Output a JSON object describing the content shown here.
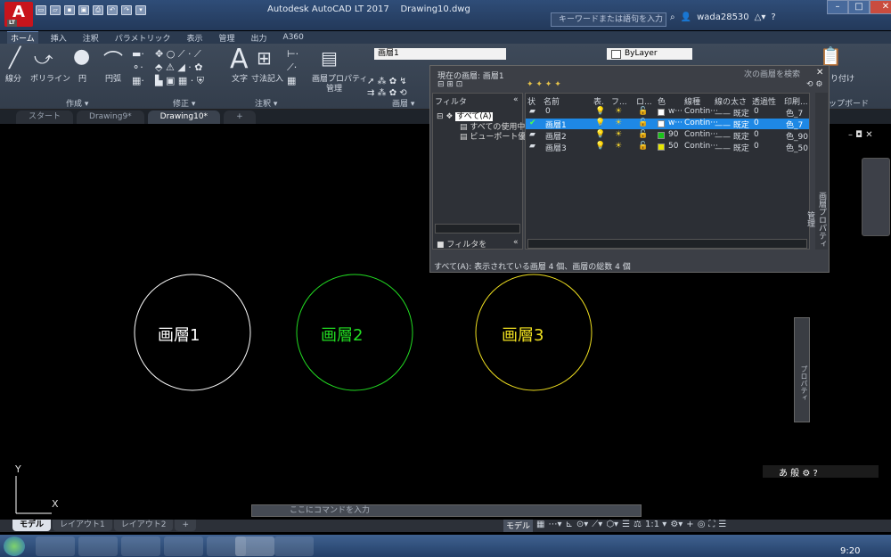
{
  "window": {
    "title": "Autodesk AutoCAD LT 2017",
    "file": "Drawing10.dwg",
    "search_placeholder": "キーワードまたは語句を入力",
    "user": "wada28530",
    "logo_letter": "A",
    "logo_sub": "LT"
  },
  "ribbon": {
    "tabs": [
      "ホーム",
      "挿入",
      "注釈",
      "パラメトリック",
      "表示",
      "管理",
      "出力",
      "A360"
    ],
    "active_tab": 0,
    "draw_tools": [
      "線分",
      "ポリライン",
      "円",
      "円弧"
    ],
    "annot_tools": [
      "文字",
      "寸法記入"
    ],
    "layer_props_label": "画層プロパティ",
    "layer_props_sub": "管理",
    "current_layer": "画層1",
    "bylayer": "ByLayer",
    "panels": {
      "draw": "作成 ▾",
      "modify": "修正 ▾",
      "annotation": "注釈 ▾",
      "layers": "画層 ▾",
      "clipboard": "ップボード",
      "paste_label": "り付け"
    }
  },
  "file_tabs": [
    "スタート",
    "Drawing9*",
    "Drawing10*",
    "+"
  ],
  "layer_palette": {
    "current": "現在の画層: 画層1",
    "search": "次の画層を検索",
    "filter_header": "フィルタ",
    "filter_collapse": "«",
    "filters": [
      "すべて(A)",
      "すべての使用中",
      "ビューポート優"
    ],
    "invert_filter": "フィルタを",
    "columns": [
      "状",
      "名前",
      "表.",
      "フ...",
      "ロ...",
      "色",
      "線種",
      "線の太さ",
      "透過性",
      "印刷..."
    ],
    "rows": [
      {
        "name": "0",
        "color_label": "w···",
        "color": "#ffffff",
        "linetype": "Contin···",
        "lineweight": "—— 既定",
        "transparency": "0",
        "plot": "色_7",
        "selected": false
      },
      {
        "name": "画層1",
        "color_label": "w···",
        "color": "#ffffff",
        "linetype": "Contin···",
        "lineweight": "—— 既定",
        "transparency": "0",
        "plot": "色_7",
        "selected": true
      },
      {
        "name": "画層2",
        "color_label": "90",
        "color": "#19c419",
        "linetype": "Contin···",
        "lineweight": "—— 既定",
        "transparency": "0",
        "plot": "色_90",
        "selected": false
      },
      {
        "name": "画層3",
        "color_label": "50",
        "color": "#e6e600",
        "linetype": "Contin···",
        "lineweight": "—— 既定",
        "transparency": "0",
        "plot": "色_50",
        "selected": false
      }
    ],
    "status": "すべて(A): 表示されている画層 4 個、画層の総数 4 個",
    "side_label": "画層プロパティ管理"
  },
  "drawing": {
    "circles": [
      {
        "label": "画層1",
        "color": "#ffffff"
      },
      {
        "label": "画層2",
        "color": "#22dd22"
      },
      {
        "label": "画層3",
        "color": "#f0e020"
      }
    ],
    "axis_y": "Y",
    "axis_x": "X"
  },
  "props_label": "プロパティ",
  "ime_text": "あ 般",
  "command_placeholder": "ここにコマンドを入力",
  "layout_tabs": [
    "モデル",
    "レイアウト1",
    "レイアウト2",
    "+"
  ],
  "status_model": "モデル",
  "status_scale": "1:1 ▾",
  "clock": "9:20"
}
